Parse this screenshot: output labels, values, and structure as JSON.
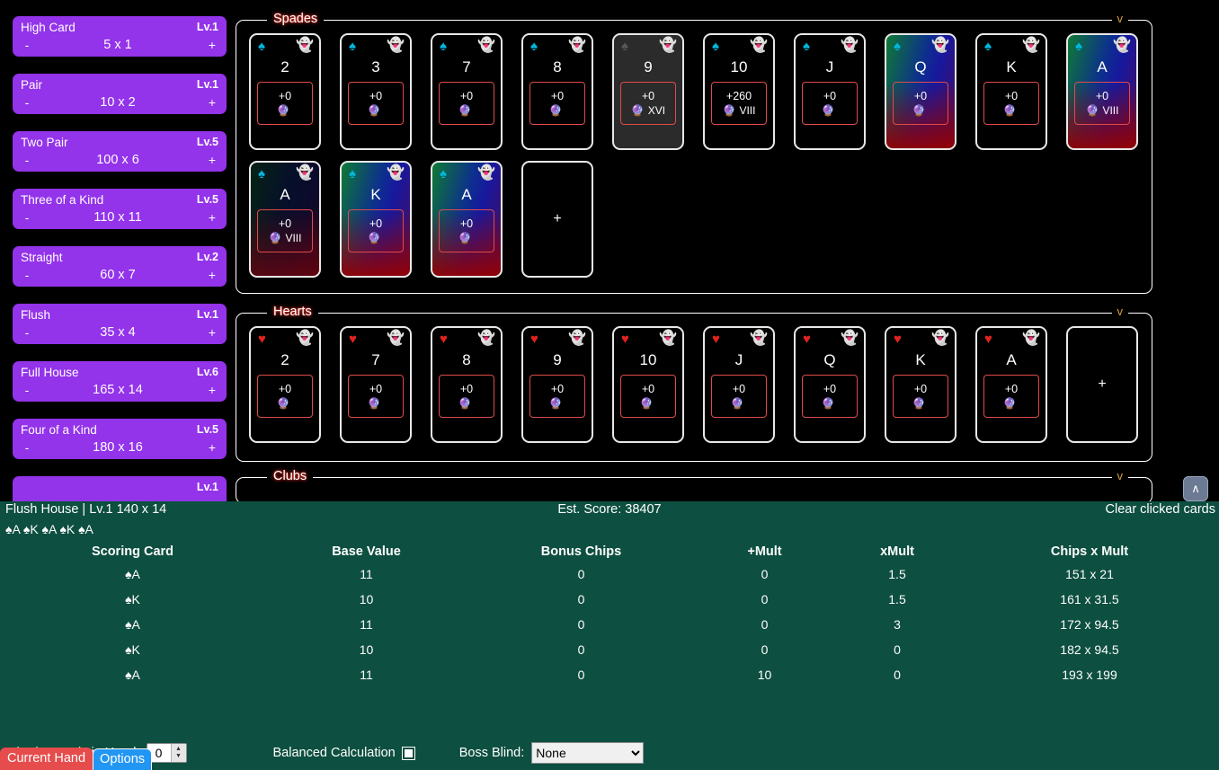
{
  "sidebar": {
    "hands": [
      {
        "name": "High Card",
        "level": "Lv.1",
        "minus": "-",
        "score": "5 x 1",
        "plus": "+"
      },
      {
        "name": "Pair",
        "level": "Lv.1",
        "minus": "-",
        "score": "10 x 2",
        "plus": "+"
      },
      {
        "name": "Two Pair",
        "level": "Lv.5",
        "minus": "-",
        "score": "100 x 6",
        "plus": "+"
      },
      {
        "name": "Three of a Kind",
        "level": "Lv.5",
        "minus": "-",
        "score": "110 x 11",
        "plus": "+"
      },
      {
        "name": "Straight",
        "level": "Lv.2",
        "minus": "-",
        "score": "60 x 7",
        "plus": "+"
      },
      {
        "name": "Flush",
        "level": "Lv.1",
        "minus": "-",
        "score": "35 x 4",
        "plus": "+"
      },
      {
        "name": "Full House",
        "level": "Lv.6",
        "minus": "-",
        "score": "165 x 14",
        "plus": "+"
      },
      {
        "name": "Four of a Kind",
        "level": "Lv.5",
        "minus": "-",
        "score": "180 x 16",
        "plus": "+"
      },
      {
        "name": "",
        "level": "Lv.1",
        "minus": "",
        "score": "",
        "plus": ""
      }
    ],
    "tabs": [
      {
        "label": "Current Hand",
        "style": "red"
      },
      {
        "label": "Options",
        "style": "blue"
      }
    ]
  },
  "groups": [
    {
      "legend": "Spades",
      "chevron": "v",
      "rows": [
        [
          {
            "suit": "spade",
            "glyph": "♠",
            "ghost": "👻",
            "rank": "2",
            "chips": "+0",
            "orb": "🔮",
            "roman": "",
            "state": "normal"
          },
          {
            "suit": "spade",
            "glyph": "♠",
            "ghost": "👻",
            "rank": "3",
            "chips": "+0",
            "orb": "🔮",
            "roman": "",
            "state": "normal"
          },
          {
            "suit": "spade",
            "glyph": "♠",
            "ghost": "👻",
            "rank": "7",
            "chips": "+0",
            "orb": "🔮",
            "roman": "",
            "state": "normal"
          },
          {
            "suit": "spade",
            "glyph": "♠",
            "ghost": "👻",
            "rank": "8",
            "chips": "+0",
            "orb": "🔮",
            "roman": "",
            "state": "normal"
          },
          {
            "suit": "grey",
            "glyph": "♠",
            "ghost": "👻",
            "rank": "9",
            "chips": "+0",
            "orb": "🔮",
            "roman": "XVI",
            "state": "disabled"
          },
          {
            "suit": "spade",
            "glyph": "♠",
            "ghost": "👻",
            "rank": "10",
            "chips": "+260",
            "orb": "🔮",
            "roman": "VIII",
            "state": "normal"
          },
          {
            "suit": "spade",
            "glyph": "♠",
            "ghost": "👻",
            "rank": "J",
            "chips": "+0",
            "orb": "🔮",
            "roman": "",
            "state": "normal"
          },
          {
            "suit": "spade",
            "glyph": "♠",
            "ghost": "👻",
            "rank": "Q",
            "chips": "+0",
            "orb": "🔮",
            "roman": "",
            "state": "selected"
          },
          {
            "suit": "spade",
            "glyph": "♠",
            "ghost": "👻",
            "rank": "K",
            "chips": "+0",
            "orb": "🔮",
            "roman": "",
            "state": "normal"
          },
          {
            "suit": "spade",
            "glyph": "♠",
            "ghost": "👻",
            "rank": "A",
            "chips": "+0",
            "orb": "🔮",
            "roman": "VIII",
            "state": "selected"
          }
        ],
        [
          {
            "suit": "spade",
            "glyph": "♠",
            "ghost": "👻",
            "rank": "A",
            "chips": "+0",
            "orb": "🔮",
            "roman": "VIII",
            "state": "selected-dim"
          },
          {
            "suit": "spade",
            "glyph": "♠",
            "ghost": "👻",
            "rank": "K",
            "chips": "+0",
            "orb": "🔮",
            "roman": "",
            "state": "selected"
          },
          {
            "suit": "spade",
            "glyph": "♠",
            "ghost": "👻",
            "rank": "A",
            "chips": "+0",
            "orb": "🔮",
            "roman": "",
            "state": "selected"
          },
          {
            "state": "empty",
            "plus": "+"
          }
        ]
      ]
    },
    {
      "legend": "Hearts",
      "chevron": "v",
      "rows": [
        [
          {
            "suit": "heart",
            "glyph": "♥",
            "ghost": "👻",
            "rank": "2",
            "chips": "+0",
            "orb": "🔮",
            "roman": "",
            "state": "normal"
          },
          {
            "suit": "heart",
            "glyph": "♥",
            "ghost": "👻",
            "rank": "7",
            "chips": "+0",
            "orb": "🔮",
            "roman": "",
            "state": "normal"
          },
          {
            "suit": "heart",
            "glyph": "♥",
            "ghost": "👻",
            "rank": "8",
            "chips": "+0",
            "orb": "🔮",
            "roman": "",
            "state": "normal"
          },
          {
            "suit": "heart",
            "glyph": "♥",
            "ghost": "👻",
            "rank": "9",
            "chips": "+0",
            "orb": "🔮",
            "roman": "",
            "state": "normal"
          },
          {
            "suit": "heart",
            "glyph": "♥",
            "ghost": "👻",
            "rank": "10",
            "chips": "+0",
            "orb": "🔮",
            "roman": "",
            "state": "normal"
          },
          {
            "suit": "heart",
            "glyph": "♥",
            "ghost": "👻",
            "rank": "J",
            "chips": "+0",
            "orb": "🔮",
            "roman": "",
            "state": "normal"
          },
          {
            "suit": "heart",
            "glyph": "♥",
            "ghost": "👻",
            "rank": "Q",
            "chips": "+0",
            "orb": "🔮",
            "roman": "",
            "state": "normal"
          },
          {
            "suit": "heart",
            "glyph": "♥",
            "ghost": "👻",
            "rank": "K",
            "chips": "+0",
            "orb": "🔮",
            "roman": "",
            "state": "normal"
          },
          {
            "suit": "heart",
            "glyph": "♥",
            "ghost": "👻",
            "rank": "A",
            "chips": "+0",
            "orb": "🔮",
            "roman": "",
            "state": "normal"
          },
          {
            "state": "empty",
            "plus": "+"
          }
        ]
      ]
    },
    {
      "legend": "Clubs",
      "chevron": "v",
      "rows": []
    }
  ],
  "collapse_button": "∧",
  "bottom": {
    "hand_summary": "Flush House | Lv.1 140 x 14",
    "est_score": "Est. Score: 38407",
    "clear_label": "Clear clicked cards",
    "played_cards": "♠A ♠K ♠A ♠K ♠A",
    "columns": [
      "Scoring Card",
      "Base Value",
      "Bonus Chips",
      "+Mult",
      "xMult",
      "Chips x Mult"
    ],
    "rows": [
      [
        "♠A",
        "11",
        "0",
        "0",
        "1.5",
        "151 x 21"
      ],
      [
        "♠K",
        "10",
        "0",
        "0",
        "1.5",
        "161 x 31.5"
      ],
      [
        "♠A",
        "11",
        "0",
        "0",
        "3",
        "172 x 94.5"
      ],
      [
        "♠K",
        "10",
        "0",
        "0",
        "0",
        "182 x 94.5"
      ],
      [
        "♠A",
        "11",
        "0",
        "10",
        "0",
        "193 x 199"
      ]
    ],
    "footer": {
      "chariot_label": "Chariot Cards in Hand:",
      "chariot_value": "0",
      "balanced_label": "Balanced Calculation",
      "balanced_checked": false,
      "boss_label": "Boss Blind:",
      "boss_value": "None",
      "boss_options": [
        "None"
      ]
    }
  },
  "colors": {
    "hand_purple": "#9333ea",
    "panel_green": "#0d4f40",
    "spade_cyan": "#00b7dd",
    "heart_red": "#e0231f",
    "mod_border": "#e04a4a"
  }
}
